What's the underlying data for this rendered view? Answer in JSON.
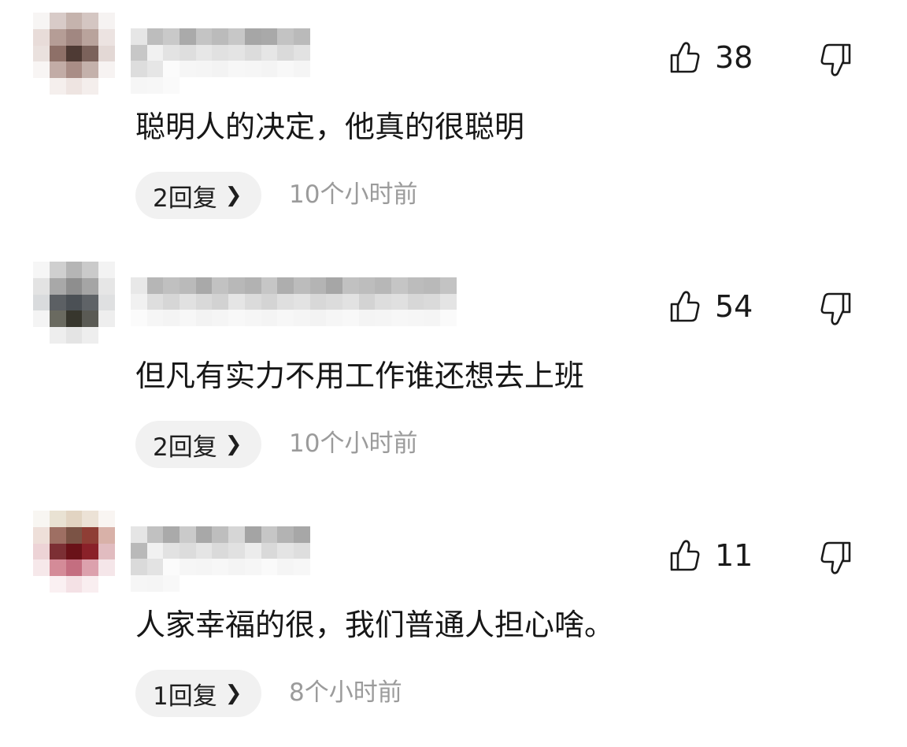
{
  "comments": [
    {
      "avatar_colors": [
        "#f7f5f4",
        "#d8cbc8",
        "#c5b3ad",
        "#d4c6c2",
        "#f6f3f2",
        "#e8dcd9",
        "#b59d96",
        "#a18781",
        "#b9a39c",
        "#ece3e1",
        "#eae1de",
        "#8e7068",
        "#4e3a34",
        "#7b625b",
        "#e3d8d5",
        "#f8f5f4",
        "#c2aca6",
        "#a98d86",
        "#c4b1ab",
        "#f7f3f2",
        "#ffffff",
        "#f5efed",
        "#eee4e1",
        "#f4eeec",
        "#ffffff"
      ],
      "username_colors": [
        "#e6e6e6",
        "#bdbdbd",
        "#c9c9c9",
        "#aaaaaa",
        "#c4c4c4",
        "#bbbbbb",
        "#c7c7c7",
        "#a6a6a6",
        "#a9a9a9",
        "#c3c3c3",
        "#bababa",
        "#c7c7c7",
        "#f1f1f1",
        "#e3e3e3",
        "#dedede",
        "#e7e7e7",
        "#e1e1e1",
        "#e4e4e4",
        "#dcdcdc",
        "#e6e6e6",
        "#dadada",
        "#e2e2e2",
        "#dddddd",
        "#e6e6e6",
        "#fbfbfb",
        "#f6f6f6",
        "#f5f5f5",
        "#f3f3f3",
        "#f7f7f7",
        "#f6f6f6",
        "#f4f4f4",
        "#f8f8f8",
        "#f5f5f5",
        "#f6f6f6",
        "#f7f7f7",
        "#fafafa"
      ],
      "like_count": "38",
      "text": "聪明人的决定，他真的很聪明",
      "reply_label": "2回复",
      "time": "10个小时前"
    },
    {
      "avatar_colors": [
        "#f6f6f6",
        "#cfcfcf",
        "#b5b5b5",
        "#cacaca",
        "#f3f3f3",
        "#e3e3e3",
        "#a8a8a8",
        "#8e8e8e",
        "#a5a5a5",
        "#e6e6e6",
        "#d9dbdd",
        "#5c6064",
        "#4b5055",
        "#5f6367",
        "#dfe0e1",
        "#f4f4f4",
        "#6a6a60",
        "#37362d",
        "#5a5a54",
        "#eeeeee",
        "#ffffff",
        "#eeeeee",
        "#e4e4e4",
        "#eeeeee",
        "#ffffff"
      ],
      "username_colors": [
        "#e8e8e8",
        "#b6b6b6",
        "#c0c0c0",
        "#bababa",
        "#a9a9a9",
        "#c2c2c2",
        "#b8b8b8",
        "#b2b2b2",
        "#c6c6c6",
        "#aeaeae",
        "#bcbcbc",
        "#b4b4b4",
        "#a6a6a6",
        "#c1c1c1",
        "#bdbdbd",
        "#b7b7b7",
        "#c5c5c5",
        "#bcbcbc",
        "#b9b9b9",
        "#c3c3c3",
        "#f1f1f1",
        "#dedede",
        "#d6d6d6",
        "#e1e1e1",
        "#d9d9d9",
        "#d2d2d2",
        "#e5e5e5",
        "#dbdbdb",
        "#d4d4d4",
        "#dfdfdf",
        "#e3e3e3",
        "#d8d8d8",
        "#dcdcdc",
        "#e2e2e2",
        "#d3d3d3",
        "#dddddd",
        "#e0e0e0",
        "#d7d7d7",
        "#dadada",
        "#e4e4e4",
        "#fbfbfb",
        "#f6f6f6",
        "#f4f4f4",
        "#f7f7f7",
        "#f3f3f3",
        "#f5f5f5",
        "#f8f8f8",
        "#f6f6f6",
        "#f4f4f4",
        "#f7f7f7",
        "#f5f5f5",
        "#f3f3f3",
        "#f6f6f6",
        "#f8f8f8",
        "#f4f4f4",
        "#f5f5f5",
        "#f7f7f7",
        "#f6f6f6",
        "#f5f5f5",
        "#fafafa"
      ],
      "like_count": "54",
      "text": "但凡有实力不用工作谁还想去上班",
      "reply_label": "2回复",
      "time": "10个小时前"
    },
    {
      "avatar_colors": [
        "#f8f6f2",
        "#e9e2d3",
        "#e2d4c2",
        "#ece2d6",
        "#f9f5f2",
        "#eedfd9",
        "#9e6f63",
        "#7b5345",
        "#8f3e35",
        "#d8b1a8",
        "#edd3d6",
        "#7c2f34",
        "#6a1218",
        "#8a2129",
        "#e1bcc0",
        "#f6e8ea",
        "#d48b98",
        "#c46e80",
        "#dca1ad",
        "#f5e6e9",
        "#ffffff",
        "#faf0f2",
        "#f4e1e5",
        "#f9eef0",
        "#ffffff"
      ],
      "username_colors": [
        "#e5e5e5",
        "#c1c1c1",
        "#aaaaaa",
        "#cacaca",
        "#a8a8a8",
        "#bebebe",
        "#d6d6d6",
        "#a4a4a4",
        "#c6c6c6",
        "#b3b3b3",
        "#a7a7a7",
        "#b9b9b9",
        "#f1f1f1",
        "#e2e2e2",
        "#dcdcdc",
        "#e5e5e5",
        "#dadada",
        "#e1e1e1",
        "#ececec",
        "#d9d9d9",
        "#e4e4e4",
        "#dedede",
        "#dadada",
        "#e3e3e3",
        "#fbfbfb",
        "#f6f6f6",
        "#f5f5f5",
        "#f7f7f7",
        "#f4f4f4",
        "#f6f6f6",
        "#fafafa",
        "#f5f5f5",
        "#f7f7f7",
        "#f6f6f6",
        "#f5f5f5",
        "#f8f8f8"
      ],
      "like_count": "11",
      "text": "人家幸福的很，我们普通人担心啥。",
      "reply_label": "1回复",
      "time": "8个小时前"
    }
  ],
  "icons": {
    "like": "thumbs-up-outline",
    "dislike": "thumbs-down-outline",
    "reply_chevron": "chevron-right"
  }
}
